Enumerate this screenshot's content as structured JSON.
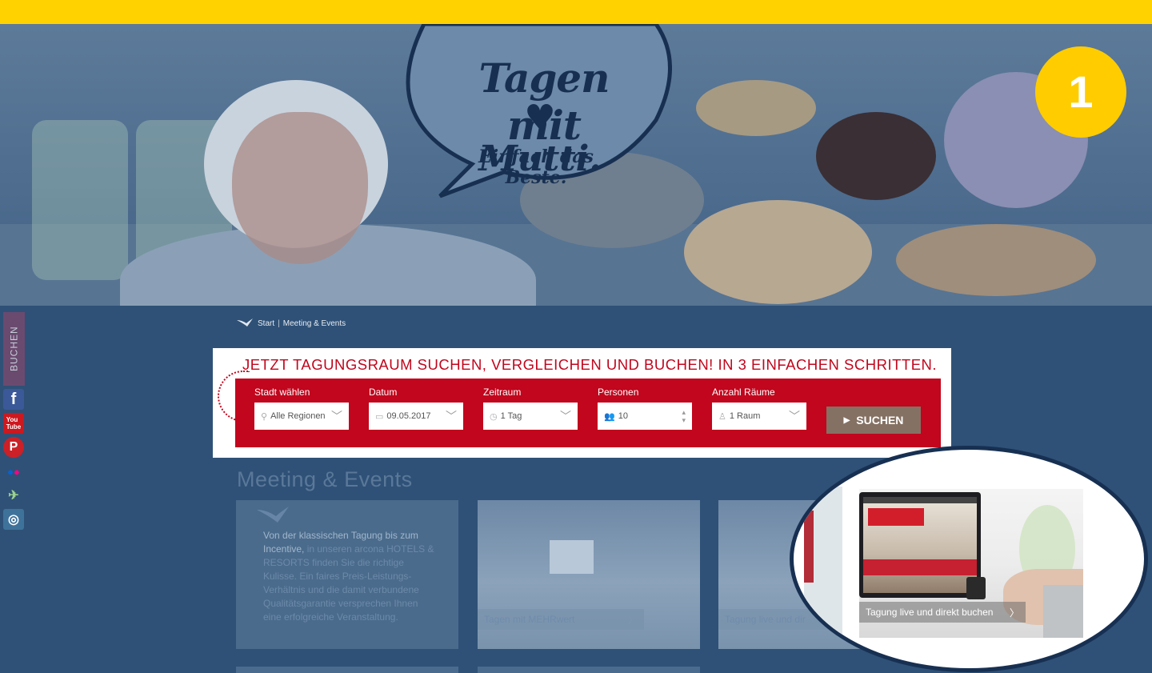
{
  "hero": {
    "slogan_line1": "Tagen mit",
    "slogan_line2": "Mutti.",
    "slogan_line3": "Einfach das Beste."
  },
  "step_badge": "1",
  "sidebar": {
    "buchen_label": "BUCHEN",
    "social": [
      {
        "name": "facebook-icon",
        "glyph": "f",
        "color": "#3b5998"
      },
      {
        "name": "youtube-icon",
        "glyph": "You",
        "color": "#cc181e"
      },
      {
        "name": "pinterest-icon",
        "glyph": "P",
        "color": "#cb2027"
      },
      {
        "name": "flickr-icon",
        "glyph": "••",
        "color": "#2f5177"
      },
      {
        "name": "tripadvisor-icon",
        "glyph": "✈",
        "color": "#2f5177"
      },
      {
        "name": "instagram-icon",
        "glyph": "◎",
        "color": "#3f729b"
      }
    ]
  },
  "breadcrumb": {
    "home": "Start",
    "separator": "|",
    "current": "Meeting & Events"
  },
  "search": {
    "title": "JETZT TAGUNGSRAUM SUCHEN, VERGLEICHEN UND BUCHEN! IN 3 EINFACHEN SCHRITTEN.",
    "fields": {
      "city": {
        "label": "Stadt wählen",
        "value": "Alle Regionen"
      },
      "date": {
        "label": "Datum",
        "value": "09.05.2017"
      },
      "period": {
        "label": "Zeitraum",
        "value": "1 Tag"
      },
      "persons": {
        "label": "Personen",
        "value": "10"
      },
      "rooms": {
        "label": "Anzahl Räume",
        "value": "1 Raum"
      }
    },
    "button_label": "SUCHEN"
  },
  "section_title": "Meeting & Events",
  "intro_card": {
    "highlight": "Von der klassischen Tagung bis zum Incentive,",
    "text": " in unseren arcona HOTELS & RESORTS finden Sie die richtige Kulisse. Ein faires Preis-Leistungs-Verhältnis und die damit verbundene Qualitätsgarantie versprechen Ihnen eine erfolgreiche Veranstaltung."
  },
  "cards": [
    {
      "caption": "Tagen mit MEHRwert"
    },
    {
      "caption": "Tagung live und dir"
    }
  ],
  "magnifier": {
    "caption": "Tagung live und direkt buchen"
  },
  "colors": {
    "topbar": "#ffd200",
    "brand_red": "#c1061d",
    "badge": "#ffcc00",
    "overlay": "#2f5177"
  }
}
